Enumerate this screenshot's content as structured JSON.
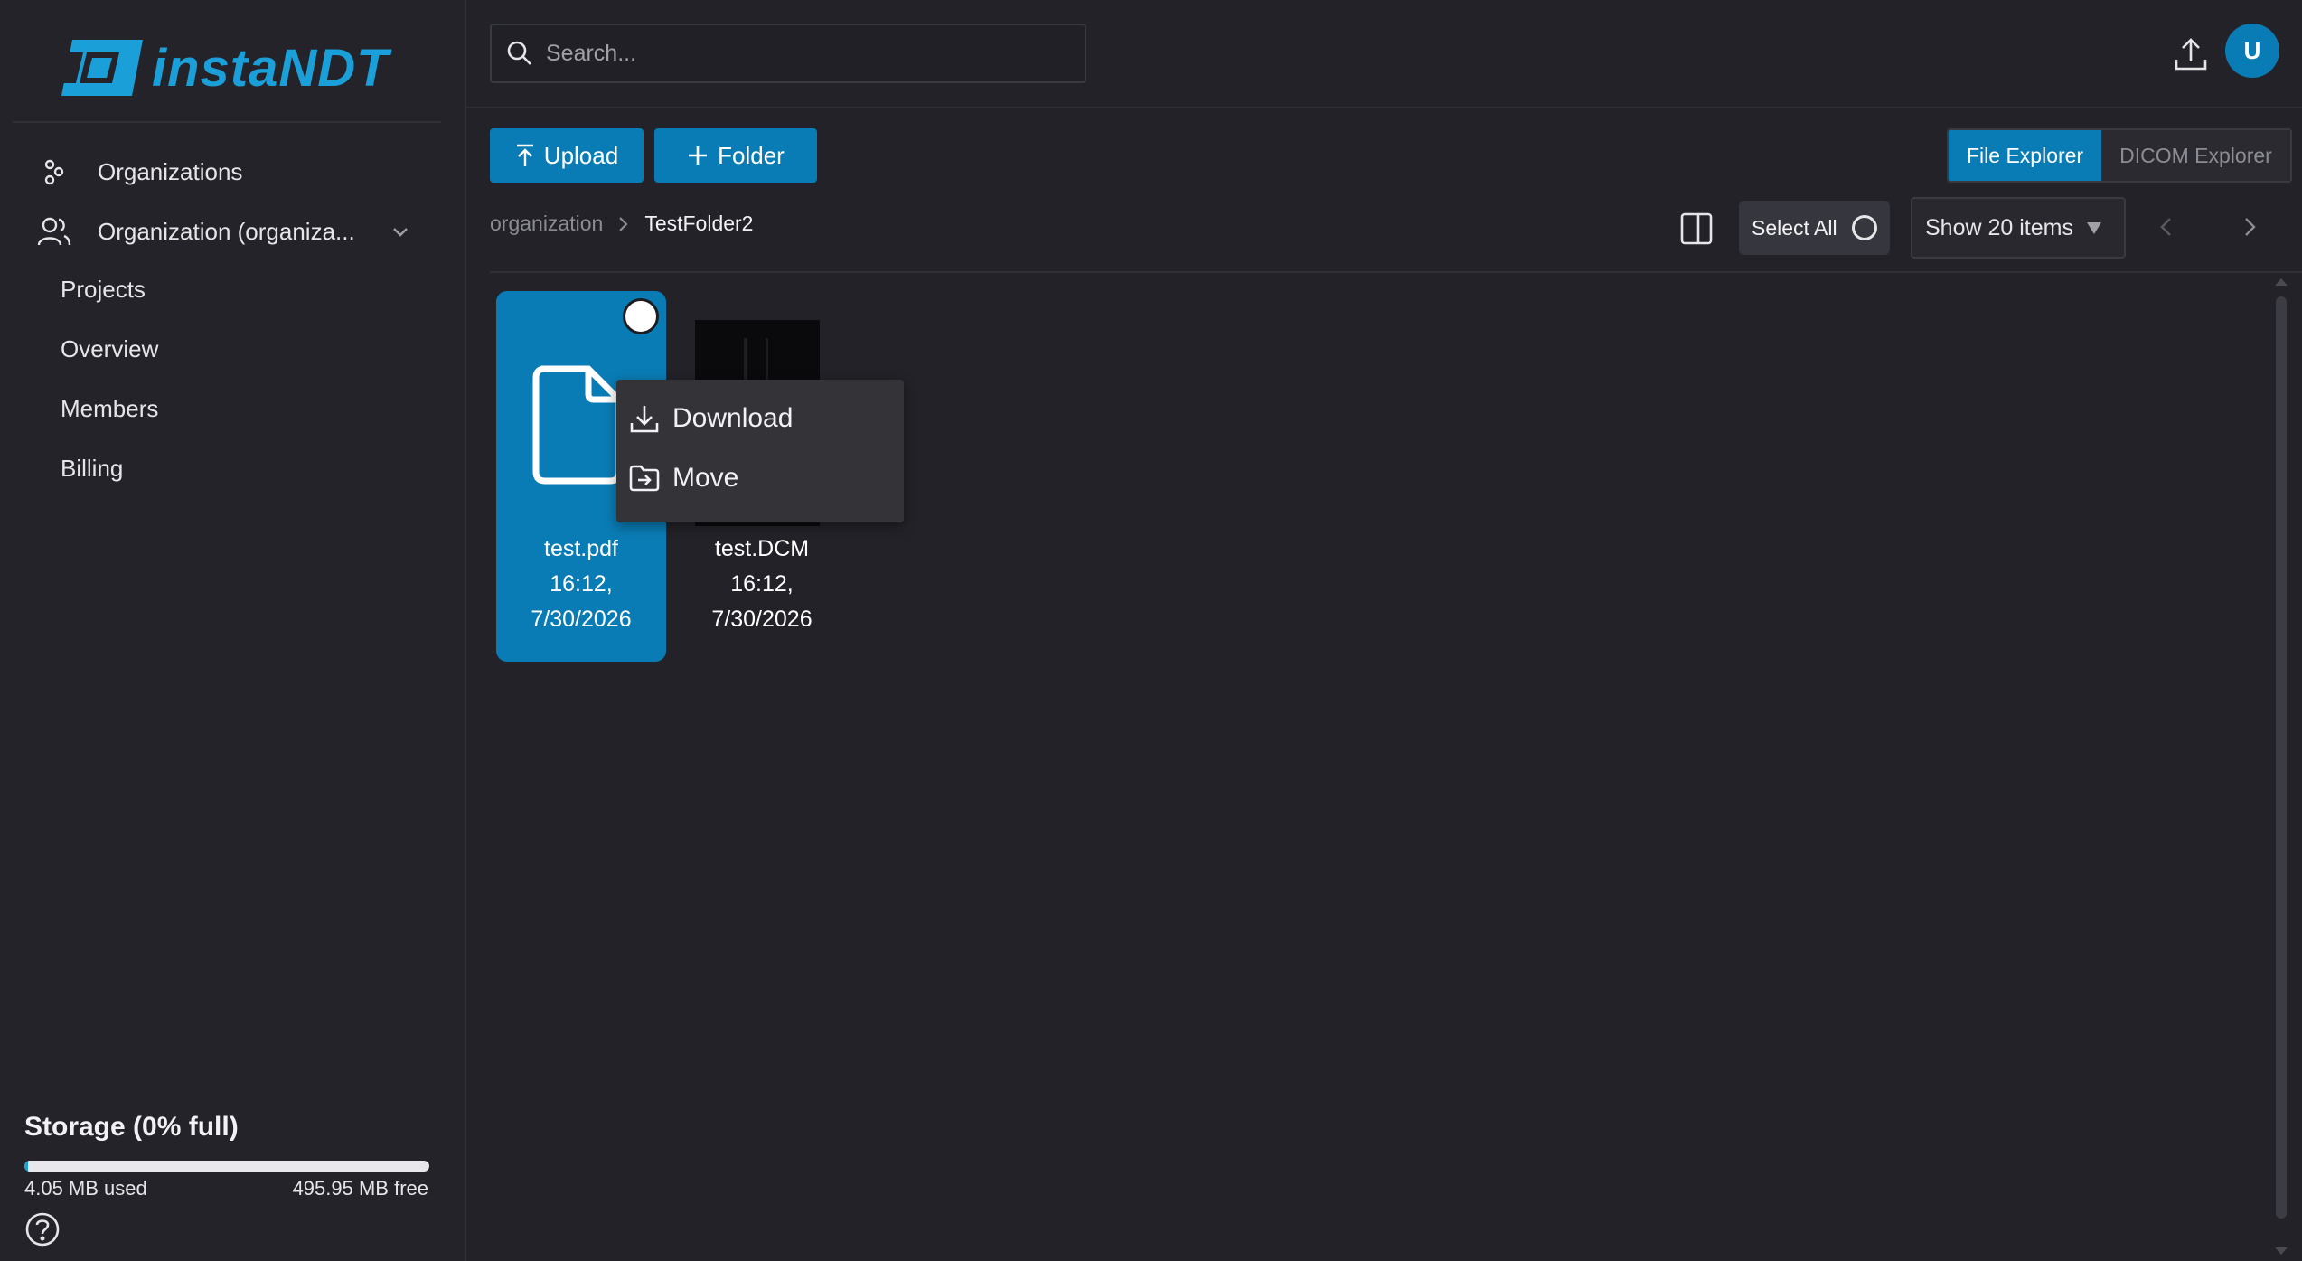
{
  "app": {
    "logo_text": "instaNDT"
  },
  "colors": {
    "accent": "#0a7cb5",
    "background": "#222228",
    "menu_bg": "#333338"
  },
  "sidebar": {
    "items": [
      {
        "label": "Organizations",
        "icon": "organizations-icon"
      },
      {
        "label": "Organization (organiza...",
        "icon": "users-icon"
      }
    ],
    "sub_items": [
      {
        "label": "Projects"
      },
      {
        "label": "Overview"
      },
      {
        "label": "Members"
      },
      {
        "label": "Billing"
      }
    ],
    "storage": {
      "title": "Storage (0% full)",
      "used": "4.05 MB used",
      "free": "495.95 MB free",
      "percent_full": 0.8
    }
  },
  "topbar": {
    "search_placeholder": "Search...",
    "avatar_letter": "U"
  },
  "toolbar": {
    "upload_label": "Upload",
    "folder_label": "Folder",
    "view_tabs": [
      {
        "label": "File Explorer",
        "active": true
      },
      {
        "label": "DICOM Explorer",
        "active": false
      }
    ],
    "select_all_label": "Select All",
    "show_items_label": "Show 20 items"
  },
  "breadcrumb": {
    "root": "organization",
    "current": "TestFolder2"
  },
  "files": [
    {
      "name": "test.pdf",
      "time": "16:12,",
      "date": "7/30/2026",
      "selected": true,
      "icon": "file-icon"
    },
    {
      "name": "test.DCM",
      "time": "16:12,",
      "date": "7/30/2026",
      "selected": false,
      "icon": "dicom-thumbnail"
    }
  ],
  "context_menu": {
    "items": [
      {
        "label": "Download",
        "icon": "download-icon"
      },
      {
        "label": "Move",
        "icon": "move-folder-icon"
      }
    ]
  }
}
